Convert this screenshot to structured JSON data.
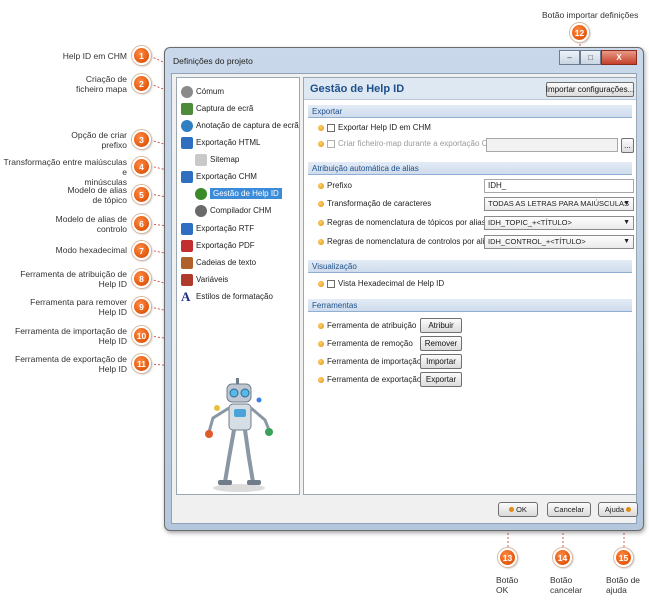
{
  "callouts": {
    "c1": {
      "num": "1",
      "text": "Help ID em CHM"
    },
    "c2": {
      "num": "2",
      "text": "Criação de\nficheiro mapa"
    },
    "c3": {
      "num": "3",
      "text": "Opção de criar\nprefixo"
    },
    "c4": {
      "num": "4",
      "text": "Transformação entre maiúsculas e\nminúsculas"
    },
    "c5": {
      "num": "5",
      "text": "Modelo de alias\nde tópico"
    },
    "c6": {
      "num": "6",
      "text": "Modelo de alias de\ncontrolo"
    },
    "c7": {
      "num": "7",
      "text": "Modo hexadecimal"
    },
    "c8": {
      "num": "8",
      "text": "Ferramenta de atribuição de\nHelp ID"
    },
    "c9": {
      "num": "9",
      "text": "Ferramenta para remover\nHelp ID"
    },
    "c10": {
      "num": "10",
      "text": "Ferramenta de importação de\nHelp ID"
    },
    "c11": {
      "num": "11",
      "text": "Ferramenta de exportação de\nHelp ID"
    },
    "c12": {
      "num": "12",
      "text": "Botão importar definições"
    },
    "c13": {
      "num": "13",
      "text": "Botão\nOK"
    },
    "c14": {
      "num": "14",
      "text": "Botão\ncancelar"
    },
    "c15": {
      "num": "15",
      "text": "Botão de\najuda"
    }
  },
  "window": {
    "title": "Definições do projeto",
    "min": "–",
    "max": "□",
    "close": "X"
  },
  "tree": [
    {
      "label": "Cómum",
      "icon": "gear-icon",
      "color": "#8a8a8a"
    },
    {
      "label": "Captura de ecrã",
      "icon": "screen-capture-icon",
      "color": "#4d8a3a"
    },
    {
      "label": "Anotação de captura de ecrã",
      "icon": "annotation-icon",
      "color": "#2f7fc1"
    },
    {
      "label": "Exportação HTML",
      "icon": "html-export-icon",
      "color": "#2f6fc1"
    },
    {
      "label": "Sitemap",
      "icon": "sitemap-icon",
      "color": "#9a9a9a"
    },
    {
      "label": "Exportação CHM",
      "icon": "chm-export-icon",
      "color": "#2f6fc1"
    },
    {
      "label": "Gestão de Help ID",
      "icon": "help-id-icon",
      "color": "#3a8a2a"
    },
    {
      "label": "Compilador CHM",
      "icon": "compiler-icon",
      "color": "#6a6a6a"
    },
    {
      "label": "Exportação RTF",
      "icon": "rtf-export-icon",
      "color": "#2f6fc1"
    },
    {
      "label": "Exportação PDF",
      "icon": "pdf-export-icon",
      "color": "#c1302f"
    },
    {
      "label": "Cadeias de texto",
      "icon": "text-strings-icon",
      "color": "#b0602a"
    },
    {
      "label": "Variáveis",
      "icon": "variables-icon",
      "color": "#b03a2a"
    },
    {
      "label": "Estilos de formatação",
      "icon": "styles-icon",
      "color": "#1d2f8a"
    }
  ],
  "main": {
    "title": "Gestão de Help ID",
    "import_button": "Importar configurações...",
    "sections": {
      "export": "Exportar",
      "alias": "Atribuição automática de alias",
      "view": "Visualização",
      "tools": "Ferramentas"
    },
    "export_help_id": "Exportar Help ID em CHM",
    "create_map": "Criar ficheiro-map durante a exportação CHM",
    "browse": "...",
    "prefix_label": "Prefixo",
    "prefix_value": "IDH_",
    "case_label": "Transformação de caracteres",
    "case_value": "TODAS AS LETRAS PARA MAIÚSCULAS",
    "topic_label": "Regras de nomenclatura de tópicos por alias",
    "topic_value": "IDH_TOPIC_+<TÍTULO>",
    "control_label": "Regras de nomenclatura de controlos por alias",
    "control_value": "IDH_CONTROL_+<TÍTULO>",
    "hex_label": "Vista Hexadecimal de Help ID",
    "tools": {
      "assign_label": "Ferramenta de atribuição",
      "assign_btn": "Atribuir",
      "remove_label": "Ferramenta de remoção",
      "remove_btn": "Remover",
      "import_label": "Ferramenta de importação",
      "import_btn": "Importar",
      "export_label": "Ferramenta de exportação",
      "export_btn": "Exportar"
    }
  },
  "footer": {
    "ok": "OK",
    "cancel": "Cancelar",
    "help": "Ajuda"
  }
}
